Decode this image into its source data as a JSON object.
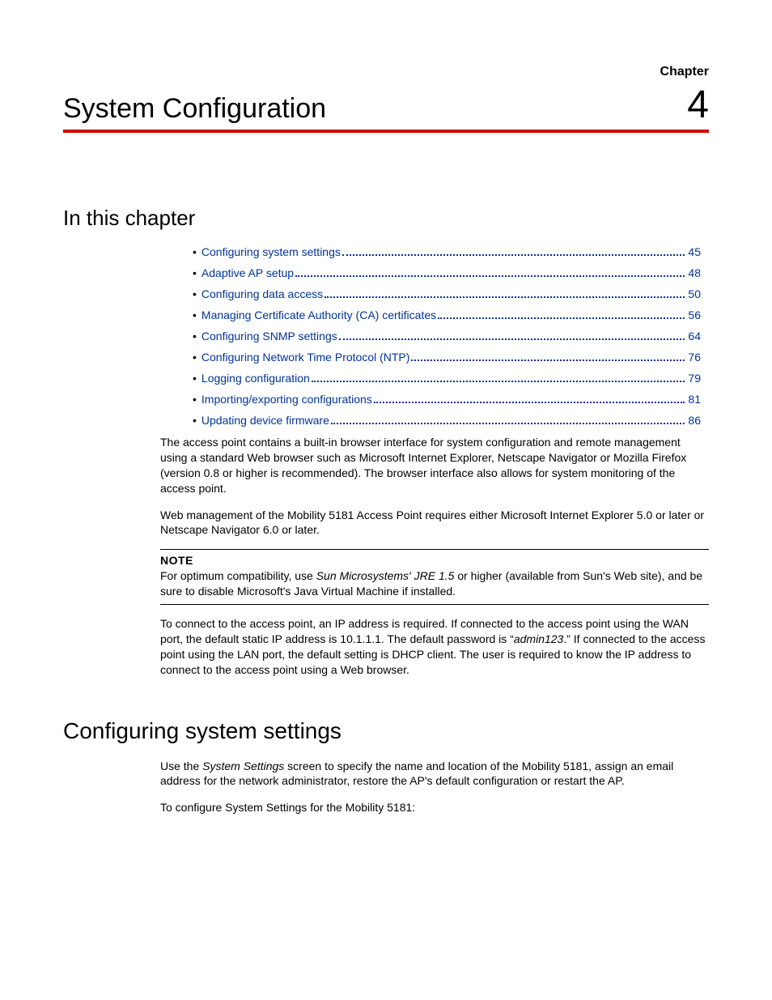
{
  "header": {
    "chapter_label": "Chapter",
    "chapter_number": "4",
    "chapter_title": "System Configuration"
  },
  "sections": {
    "in_this_chapter": "In this chapter",
    "configuring_sys": "Configuring system settings"
  },
  "toc": [
    {
      "label": "Configuring system settings",
      "page": "45"
    },
    {
      "label": "Adaptive AP setup",
      "page": "48"
    },
    {
      "label": "Configuring data access",
      "page": "50"
    },
    {
      "label": "Managing Certificate Authority (CA) certificates",
      "page": "56"
    },
    {
      "label": "Configuring SNMP settings",
      "page": "64"
    },
    {
      "label": "Configuring Network Time Protocol (NTP)",
      "page": "76"
    },
    {
      "label": "Logging configuration",
      "page": "79"
    },
    {
      "label": "Importing/exporting configurations",
      "page": "81"
    },
    {
      "label": "Updating device firmware",
      "page": "86"
    }
  ],
  "body": {
    "p1": "The access point contains a built-in browser interface for system configuration and remote management using a standard Web browser such as Microsoft Internet Explorer, Netscape Navigator or Mozilla Firefox (version 0.8 or higher is recommended). The browser interface also allows for system monitoring of the access point.",
    "p2": "Web management of the Mobility 5181 Access Point requires either Microsoft Internet Explorer 5.0 or later or Netscape Navigator 6.0 or later.",
    "note_label": "NOTE",
    "note_pre": "For optimum compatibility, use ",
    "note_em": "Sun Microsystems' JRE 1.5",
    "note_post": " or higher (available from Sun's Web site), and be sure to disable Microsoft's Java Virtual Machine if installed.",
    "p3_a": "To connect to the access point, an IP address is required. If connected to the access point using the WAN port, the default static IP address is 10.1.1.1. The default password is “",
    "p3_em": "admin123",
    "p3_b": ".” If connected to the access point using the LAN port, the default setting is DHCP client. The user is required to know the IP address to connect to the access point using a Web browser.",
    "p4_a": "Use the ",
    "p4_em": "System Settings",
    "p4_b": " screen to specify the name and location of the Mobility 5181, assign an email address for the network administrator, restore the AP's default configuration or restart the AP.",
    "p5": "To configure System Settings for the Mobility 5181:"
  }
}
